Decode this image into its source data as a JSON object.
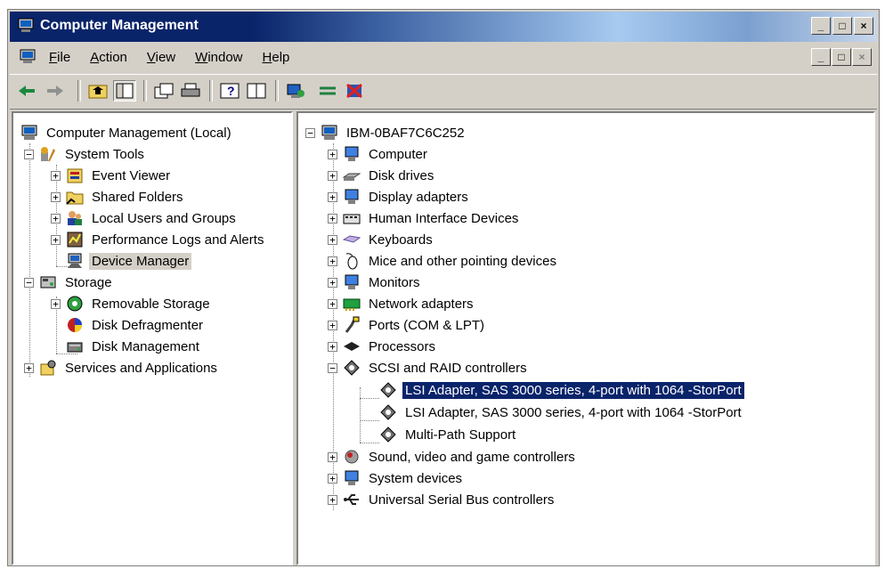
{
  "window": {
    "title": "Computer Management"
  },
  "title_buttons": [
    "_",
    "□",
    "×"
  ],
  "menu": {
    "items": [
      "File",
      "Action",
      "View",
      "Window",
      "Help"
    ]
  },
  "toolbar": {
    "tools": [
      "back-icon",
      "forward-icon",
      "up-folder-icon",
      "show-hide-tree-icon",
      "properties-icon",
      "print-icon",
      "help-icon",
      "mmc-view-icon",
      "scan-hardware-icon",
      "update-driver-icon",
      "uninstall-icon"
    ]
  },
  "left_tree": {
    "root": "Computer Management (Local)",
    "system_tools": "System Tools",
    "event_viewer": "Event Viewer",
    "shared_folders": "Shared Folders",
    "local_users": "Local Users and Groups",
    "perf_logs": "Performance Logs and Alerts",
    "device_manager": "Device Manager",
    "storage": "Storage",
    "removable_storage": "Removable Storage",
    "disk_defrag": "Disk Defragmenter",
    "disk_mgmt": "Disk Management",
    "services": "Services and Applications"
  },
  "right_tree": {
    "root": "IBM-0BAF7C6C252",
    "categories": [
      "Computer",
      "Disk drives",
      "Display adapters",
      "Human Interface Devices",
      "Keyboards",
      "Mice and other pointing devices",
      "Monitors",
      "Network adapters",
      "Ports (COM & LPT)",
      "Processors",
      "SCSI and RAID controllers"
    ],
    "scsi_children": [
      "LSI Adapter, SAS 3000 series, 4-port with 1064 -StorPort",
      "LSI Adapter, SAS 3000 series, 4-port with 1064 -StorPort",
      "Multi-Path Support"
    ],
    "trailing": [
      "Sound, video and game controllers",
      "System devices",
      "Universal Serial Bus controllers"
    ]
  }
}
